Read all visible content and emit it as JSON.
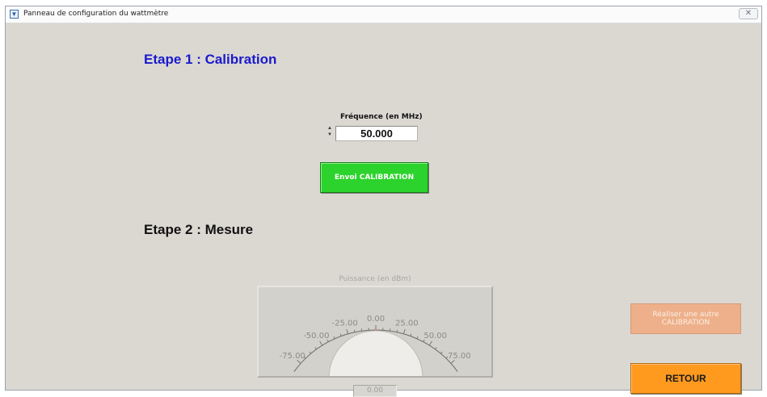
{
  "window": {
    "title": "Panneau de configuration du wattmètre",
    "close_glyph": "✕"
  },
  "step1": {
    "heading": "Etape 1 : Calibration",
    "heading_color": "#1a1acc",
    "frequency_label": "Fréquence (en MHz)",
    "frequency_value": "50.000",
    "send_button": "Envoi CALIBRATION",
    "send_button_color": "#2cd32c"
  },
  "step2": {
    "heading": "Etape 2 : Mesure",
    "heading_color": "#111111",
    "gauge": {
      "label": "Puissance (en dBm)",
      "ticks": [
        "-75.00",
        "-50.00",
        "-25.00",
        "0.00",
        "25.00",
        "50.00",
        "75.00"
      ],
      "needle_value": 0.0,
      "readout": "0.00",
      "needle_color": "#d08a8a"
    }
  },
  "buttons": {
    "recalibrate": "Réaliser une autre CALIBRATION",
    "recalibrate_enabled": false,
    "back": "RETOUR",
    "back_color": "#ff9a1f"
  },
  "icons": {
    "app": "window-app-icon",
    "spinner_up": "▲",
    "spinner_down": "▼"
  }
}
